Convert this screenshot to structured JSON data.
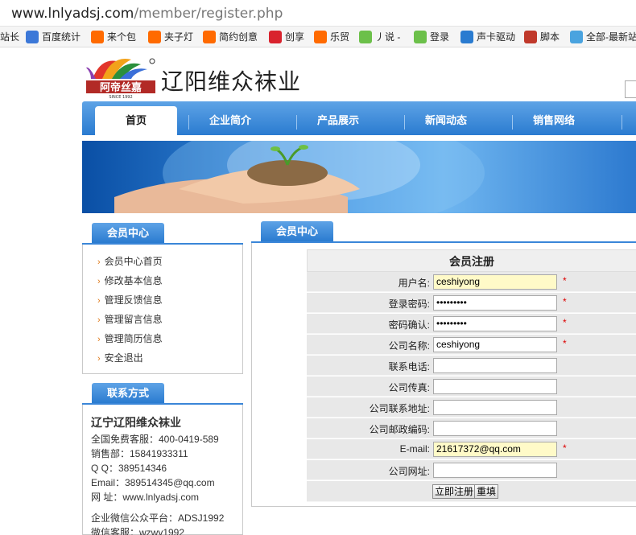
{
  "browser": {
    "url_host": "www.lnlyadsj.com",
    "url_path": "/member/register.php",
    "bookmarks": [
      {
        "label": "站长",
        "icon": "bookmark-icon",
        "color": "#ffffff"
      },
      {
        "label": "百度统计",
        "icon": "chart-icon",
        "color": "#3c78d8"
      },
      {
        "label": "来个包",
        "icon": "taobao-icon",
        "color": "#ff6a00"
      },
      {
        "label": "夹子灯",
        "icon": "taobao-icon",
        "color": "#ff6a00"
      },
      {
        "label": "简约创意",
        "icon": "taobao-icon",
        "color": "#ff6a00"
      },
      {
        "label": "创享",
        "icon": "t-icon",
        "color": "#d9232e"
      },
      {
        "label": "乐贸",
        "icon": "taobao-icon",
        "color": "#ff6a00"
      },
      {
        "label": "丿说 -",
        "icon": "say-icon",
        "color": "#6cc04a"
      },
      {
        "label": "登录",
        "icon": "say-icon",
        "color": "#6cc04a"
      },
      {
        "label": "声卡驱动",
        "icon": "six-icon",
        "color": "#2a7bd0"
      },
      {
        "label": "脚本",
        "icon": "b-icon",
        "color": "#c0392b"
      },
      {
        "label": "全部-最新站",
        "icon": "nine-icon",
        "color": "#4aa3df"
      }
    ]
  },
  "header": {
    "logo_text": "阿帝丝嘉",
    "logo_since": "SINCE 1992",
    "site_title": "辽阳维众袜业"
  },
  "nav": {
    "items": [
      {
        "label": "首页",
        "active": true
      },
      {
        "label": "企业简介",
        "active": false
      },
      {
        "label": "产品展示",
        "active": false
      },
      {
        "label": "新闻动态",
        "active": false
      },
      {
        "label": "销售网络",
        "active": false
      }
    ]
  },
  "sidebar": {
    "member_title": "会员中心",
    "links": [
      "会员中心首页",
      "修改基本信息",
      "管理反馈信息",
      "管理留言信息",
      "管理简历信息",
      "安全退出"
    ],
    "contact_title": "联系方式",
    "contact": {
      "company": "辽宁辽阳维众袜业",
      "lines": [
        "全国免费客服：400-0419-589",
        "销售部：15841933311",
        "Q  Q：389514346",
        "Email：389514345@qq.com",
        "网  址：www.lnlyadsj.com",
        "企业微信公众平台：ADSJ1992",
        "微信客服：wzwy1992"
      ]
    }
  },
  "main": {
    "panel_title": "会员中心",
    "form_title": "会员注册",
    "fields": [
      {
        "label": "用户名:",
        "value": "ceshiyong",
        "required": true,
        "highlight": true
      },
      {
        "label": "登录密码:",
        "value": "•••••••••",
        "required": true,
        "highlight": false
      },
      {
        "label": "密码确认:",
        "value": "•••••••••",
        "required": true,
        "highlight": false
      },
      {
        "label": "公司名称:",
        "value": "ceshiyong",
        "required": true,
        "highlight": false
      },
      {
        "label": "联系电话:",
        "value": "",
        "required": false,
        "highlight": false
      },
      {
        "label": "公司传真:",
        "value": "",
        "required": false,
        "highlight": false
      },
      {
        "label": "公司联系地址:",
        "value": "",
        "required": false,
        "highlight": false
      },
      {
        "label": "公司邮政编码:",
        "value": "",
        "required": false,
        "highlight": false
      },
      {
        "label": "E-mail:",
        "value": "21617372@qq.com",
        "required": true,
        "highlight": true
      },
      {
        "label": "公司网址:",
        "value": "",
        "required": false,
        "highlight": false
      }
    ],
    "required_mark": "*",
    "submit_label": "立即注册",
    "reset_label": "重填"
  },
  "colors": {
    "nav_blue": "#2a7bd0",
    "required_red": "#d00000",
    "autofill_yellow": "#fffac8"
  }
}
